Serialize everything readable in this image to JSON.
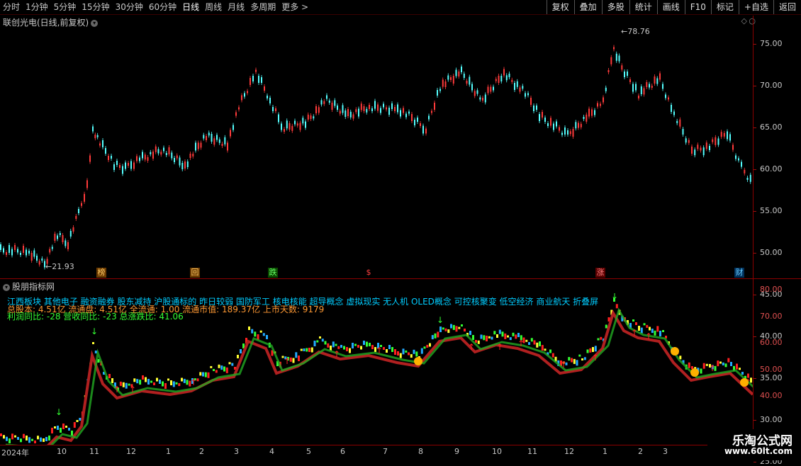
{
  "toolbar": {
    "periods": [
      "分时",
      "1分钟",
      "5分钟",
      "15分钟",
      "30分钟",
      "60分钟",
      "日线",
      "周线",
      "月线",
      "多周期",
      "更多 >"
    ],
    "active": "日线",
    "buttons": [
      "复权",
      "叠加",
      "多股",
      "统计",
      "画线",
      "F10",
      "标记",
      "+自选",
      "返回"
    ]
  },
  "main_panel": {
    "title": "联创光电(日线,前复权)",
    "price_ticks": [
      "75.00",
      "70.00",
      "65.00",
      "60.00",
      "55.00",
      "50.00",
      "45.00",
      "40.00",
      "35.00",
      "30.00",
      "25.00"
    ],
    "high_label": "78.76",
    "low_label": "21.93",
    "event_markers": [
      "榜",
      "回",
      "跌",
      "$",
      "涨",
      "财"
    ],
    "colors": {
      "up": "#ff3b3b",
      "down": "#54ffff"
    }
  },
  "indicator_panel": {
    "title": "股朋指标网",
    "line1": "江西板块 其他电子 融资融券 股东减持 沪股通标的 昨日较弱 国防军工 核电核能 超导概念 虚拟现实 无人机 OLED概念 可控核聚变 低空经济 商业航天 折叠屏",
    "line2": "总股本: 4.51亿 流通盘: 4.51亿 全流通: 1.00 流通市值: 189.37亿 上市天数: 9179",
    "line3": "利润同比: -28 营收同比: -23 总涨跌比: 41.06",
    "ticks": [
      "80.00",
      "70.00",
      "60.00",
      "50.00",
      "40.00"
    ],
    "colors": {
      "line1": "#00ccff",
      "line2": "#ff9933",
      "line3": "#33ff33"
    }
  },
  "date_axis": [
    "2024年",
    "10",
    "11",
    "12",
    "1",
    "2",
    "3",
    "4",
    "5",
    "6",
    "7",
    "8",
    "9",
    "10",
    "11",
    "12",
    "1",
    "2",
    "3"
  ],
  "watermark": {
    "name": "乐淘公式网",
    "url": "www.60lt.com"
  }
}
